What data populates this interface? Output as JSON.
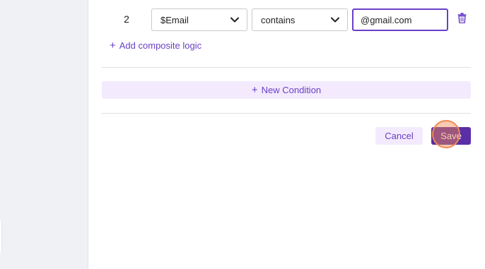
{
  "condition_row": {
    "index": "2",
    "field_value": "$Email",
    "operator_value": "contains",
    "input_value": "@gmail.com"
  },
  "add_composite_logic_label": "Add composite logic",
  "new_condition_label": "New Condition",
  "footer": {
    "cancel_label": "Cancel",
    "save_label": "Save"
  },
  "colors": {
    "accent": "#6a3fc7",
    "primary_button": "#5a2ea6",
    "soft_button": "#f3ebfd",
    "click_marker": "#f08a50"
  }
}
